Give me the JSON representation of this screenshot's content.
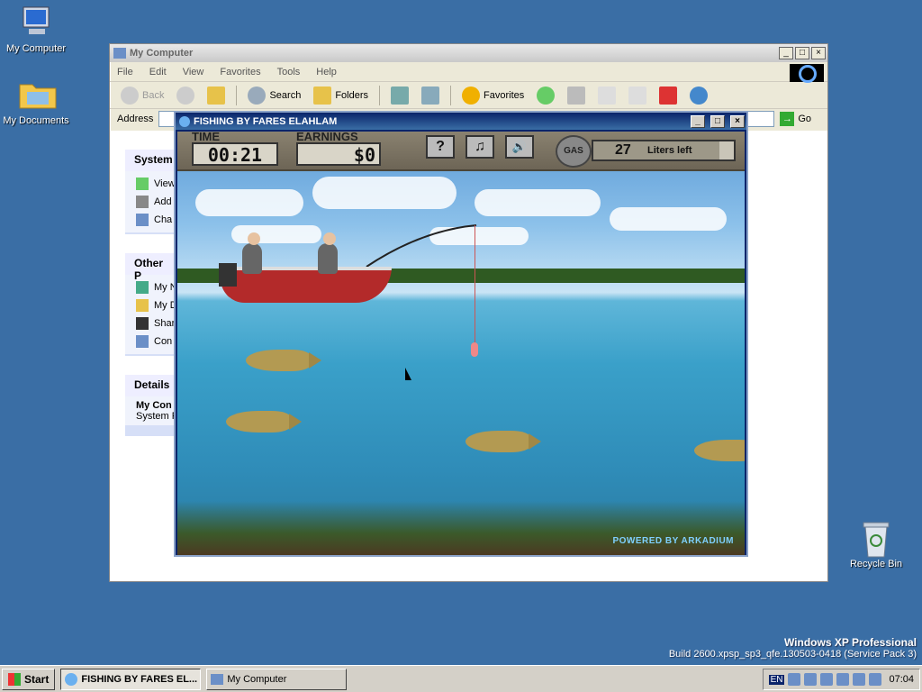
{
  "desktop": {
    "icons": [
      {
        "label": "My Computer",
        "icon": "my-computer-icon"
      },
      {
        "label": "My Documents",
        "icon": "folder-icon"
      },
      {
        "label": "Recycle Bin",
        "icon": "recycle-bin-icon"
      }
    ],
    "os_name": "Windows XP Professional",
    "build": "Build 2600.xpsp_sp3_qfe.130503-0418 (Service Pack 3)"
  },
  "explorer": {
    "title": "My Computer",
    "menu": [
      "File",
      "Edit",
      "View",
      "Favorites",
      "Tools",
      "Help"
    ],
    "toolbar": {
      "back": "Back",
      "search": "Search",
      "folders": "Folders",
      "favorites": "Favorites"
    },
    "address_label": "Address",
    "go_label": "Go",
    "panels": [
      {
        "title": "System",
        "items": [
          "View",
          "Add",
          "Cha"
        ]
      },
      {
        "title": "Other P",
        "items": [
          "My N",
          "My D",
          "Shar",
          "Con"
        ]
      },
      {
        "title": "Details",
        "items": [
          "My Con",
          "System F"
        ]
      }
    ]
  },
  "game": {
    "title": "FISHING BY FARES ELAHLAM",
    "time_label": "TIME",
    "time_value": "00:21",
    "earnings_label": "EARNINGS",
    "earnings_value": "$0",
    "help_glyph": "?",
    "music_glyph": "♫",
    "sound_glyph": "🔊",
    "gas_label": "GAS",
    "gas_value": "27",
    "gas_text": "Liters left",
    "gas_fraction": 0.9,
    "powered_by": "POWERED BY ARKADIUM"
  },
  "taskbar": {
    "start_label": "Start",
    "tasks": [
      {
        "label": "FISHING BY FARES EL...",
        "active": true
      },
      {
        "label": "My Computer",
        "active": false
      }
    ],
    "lang": "EN",
    "clock": "07:04"
  }
}
